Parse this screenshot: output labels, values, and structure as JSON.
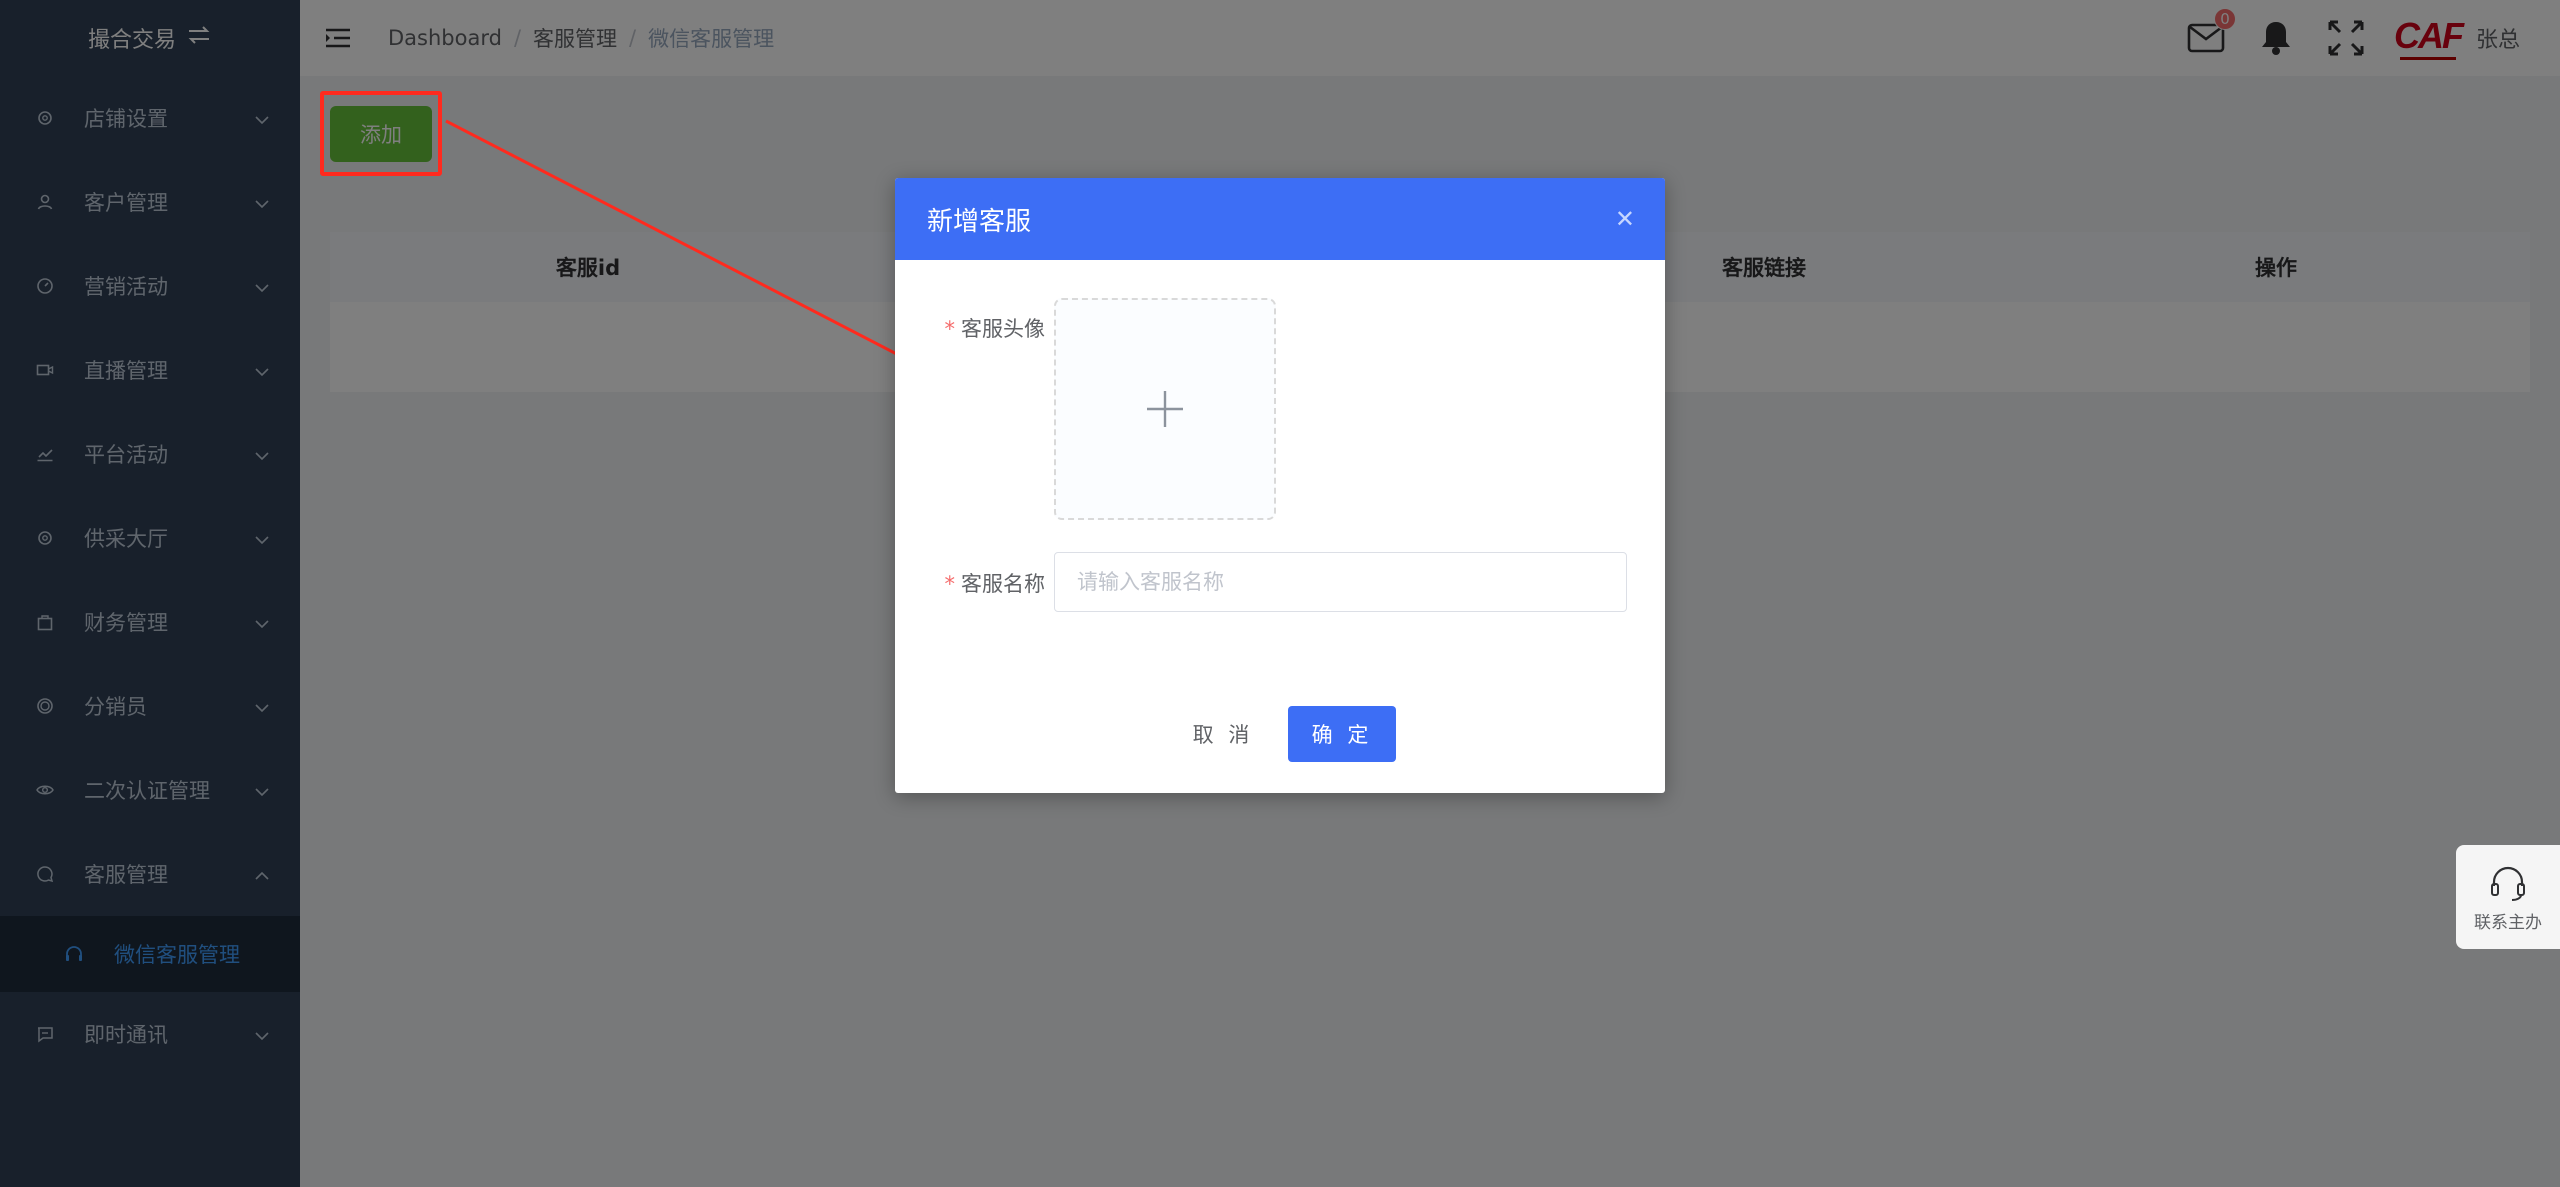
{
  "sidebar": {
    "title": "撮合交易",
    "items": [
      {
        "label": "店铺设置",
        "icon": "gear-icon"
      },
      {
        "label": "客户管理",
        "icon": "user-icon"
      },
      {
        "label": "营销活动",
        "icon": "compass-icon"
      },
      {
        "label": "直播管理",
        "icon": "camera-icon"
      },
      {
        "label": "平台活动",
        "icon": "chart-icon"
      },
      {
        "label": "供采大厅",
        "icon": "gear-icon"
      },
      {
        "label": "财务管理",
        "icon": "bag-icon"
      },
      {
        "label": "分销员",
        "icon": "circle-icon"
      },
      {
        "label": "二次认证管理",
        "icon": "eye-icon"
      },
      {
        "label": "客服管理",
        "icon": "chat-icon"
      }
    ],
    "active_sub": {
      "label": "微信客服管理",
      "icon": "headset-icon"
    },
    "last_item": {
      "label": "即时通讯",
      "icon": "message-icon"
    }
  },
  "header": {
    "breadcrumb": [
      "Dashboard",
      "客服管理",
      "微信客服管理"
    ],
    "mail_badge": "0",
    "logo_text": "CAF",
    "username": "张总"
  },
  "main": {
    "add_button": "添加",
    "table_headers": [
      "客服id",
      "客服链接",
      "操作"
    ]
  },
  "dialog": {
    "title": "新增客服",
    "avatar_label": "客服头像",
    "name_label": "客服名称",
    "name_placeholder": "请输入客服名称",
    "name_value": "",
    "cancel": "取 消",
    "confirm": "确 定"
  },
  "contact": {
    "label": "联系主办"
  },
  "colors": {
    "sidebar_bg": "#304156",
    "primary": "#3d6ef5",
    "success": "#67c23a",
    "annotation": "#ff2a1e"
  }
}
